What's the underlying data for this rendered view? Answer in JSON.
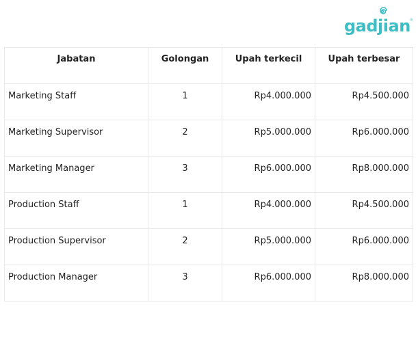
{
  "brand": {
    "name": "gadjian",
    "color": "#3dbdc4"
  },
  "table": {
    "headers": [
      "Jabatan",
      "Golongan",
      "Upah terkecil",
      "Upah terbesar"
    ],
    "rows": [
      {
        "jabatan": "Marketing Staff",
        "golongan": "1",
        "min": "Rp4.000.000",
        "max": "Rp4.500.000"
      },
      {
        "jabatan": "Marketing Supervisor",
        "golongan": "2",
        "min": "Rp5.000.000",
        "max": "Rp6.000.000"
      },
      {
        "jabatan": "Marketing Manager",
        "golongan": "3",
        "min": "Rp6.000.000",
        "max": "Rp8.000.000"
      },
      {
        "jabatan": "Production Staff",
        "golongan": "1",
        "min": "Rp4.000.000",
        "max": "Rp4.500.000"
      },
      {
        "jabatan": "Production Supervisor",
        "golongan": "2",
        "min": "Rp5.000.000",
        "max": "Rp6.000.000"
      },
      {
        "jabatan": "Production Manager",
        "golongan": "3",
        "min": "Rp6.000.000",
        "max": "Rp8.000.000"
      }
    ]
  }
}
